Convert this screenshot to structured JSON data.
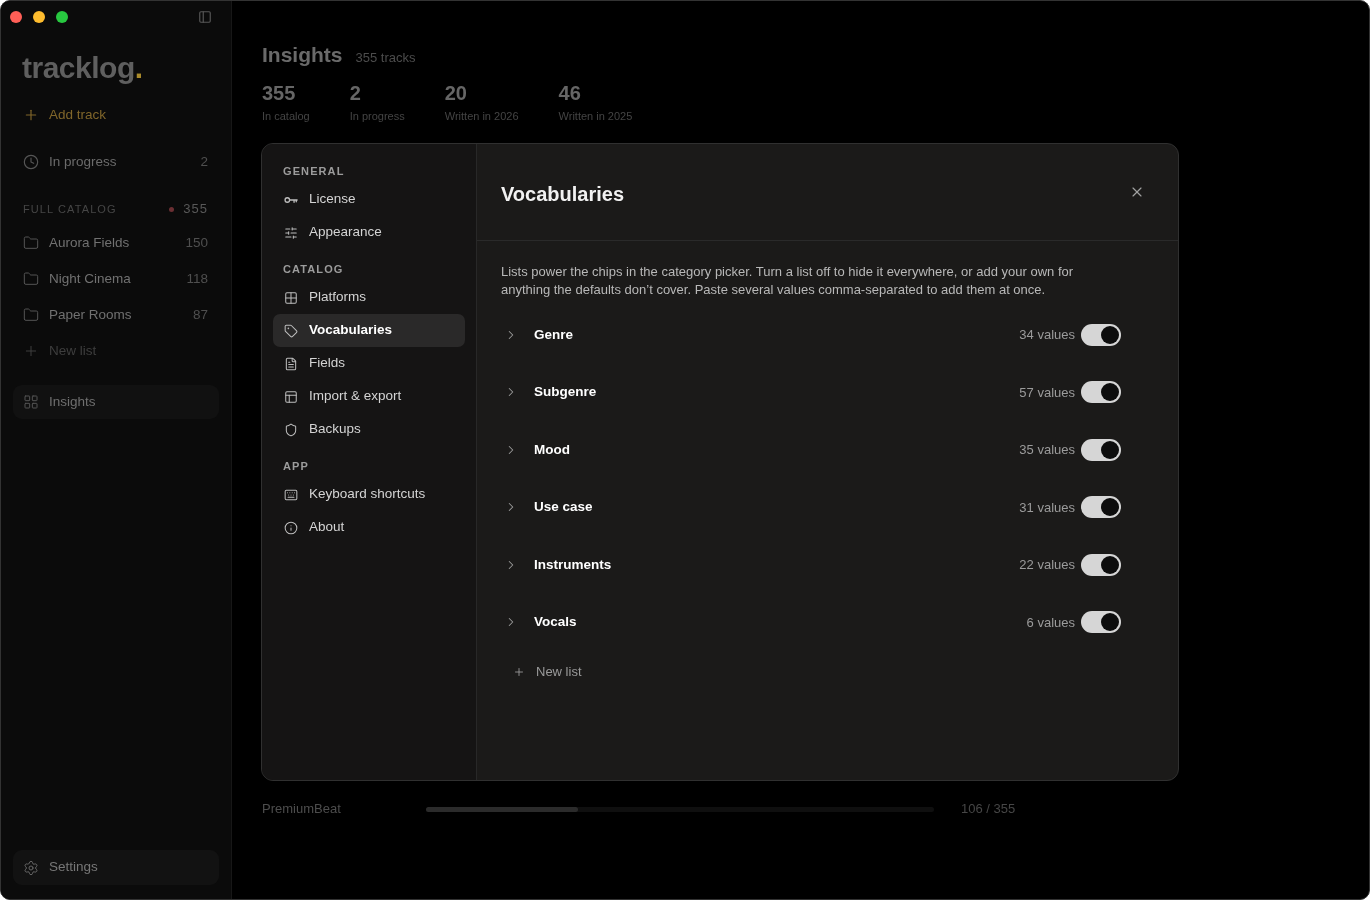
{
  "sidebar": {
    "logo": {
      "name": "tracklog",
      "accent": "."
    },
    "add_track": "Add track",
    "shortcuts": [
      {
        "label": "In progress",
        "count": "2",
        "selected": false
      }
    ],
    "catalog": {
      "heading": "FULL CATALOG",
      "count": "355",
      "lists": [
        {
          "name": "Aurora Fields",
          "count": "150",
          "selected": false
        },
        {
          "name": "Night Cinema",
          "count": "118",
          "selected": false
        },
        {
          "name": "Paper Rooms",
          "count": "87",
          "selected": false
        }
      ],
      "new_list": "New list"
    },
    "views": [
      {
        "label": "Insights",
        "selected": true
      }
    ],
    "settings": {
      "label": "Settings",
      "selected": true
    }
  },
  "header": {
    "title": "Insights",
    "subtitle": "355 tracks",
    "stats": [
      {
        "value": "355",
        "label": "In catalog"
      },
      {
        "value": "2",
        "label": "In progress"
      },
      {
        "value": "20",
        "label": "Written in 2026"
      },
      {
        "value": "46",
        "label": "Written in 2025"
      }
    ]
  },
  "settings_dialog": {
    "nav": [
      {
        "heading": "GENERAL",
        "items": [
          {
            "label": "License",
            "selected": false
          },
          {
            "label": "Appearance",
            "selected": false
          }
        ]
      },
      {
        "heading": "CATALOG",
        "items": [
          {
            "label": "Platforms",
            "selected": false
          },
          {
            "label": "Vocabularies",
            "selected": true
          },
          {
            "label": "Fields",
            "selected": false
          },
          {
            "label": "Import & export",
            "selected": false
          },
          {
            "label": "Backups",
            "selected": false
          }
        ]
      },
      {
        "heading": "APP",
        "items": [
          {
            "label": "Keyboard shortcuts",
            "selected": false
          },
          {
            "label": "About",
            "selected": false
          }
        ]
      }
    ],
    "title": "Vocabularies",
    "description": "Lists power the chips in the category picker. Turn a list off to hide it everywhere, or add your own for anything the defaults don’t cover. Paste several values comma-separated to add them at once.",
    "lists": [
      {
        "name": "Genre",
        "count": "34 values",
        "expanded": false,
        "on": true
      },
      {
        "name": "Subgenre",
        "count": "57 values",
        "expanded": false,
        "on": true
      },
      {
        "name": "Mood",
        "count": "35 values",
        "expanded": false,
        "on": true
      },
      {
        "name": "Use case",
        "count": "31 values",
        "expanded": false,
        "on": true
      },
      {
        "name": "Instruments",
        "count": "22 values",
        "expanded": false,
        "on": true
      },
      {
        "name": "Vocals",
        "count": "6 values",
        "expanded": false,
        "on": true
      }
    ],
    "new_list": "New list"
  },
  "progress": {
    "label": "PremiumBeat",
    "level": 0.3,
    "reading": "106 / 355"
  }
}
